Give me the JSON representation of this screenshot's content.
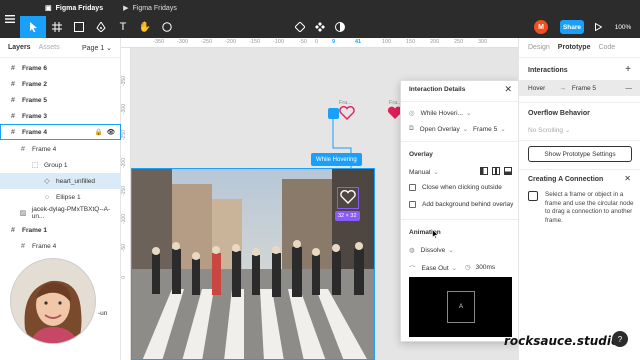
{
  "toolbar": {
    "tabs": [
      "Figma Fridays",
      "Figma Fridays"
    ],
    "avatar_letter": "M",
    "share_label": "Share",
    "zoom": "100%"
  },
  "left_panel": {
    "tab_layers": "Layers",
    "tab_assets": "Assets",
    "page": "Page 1",
    "layers": [
      {
        "label": "Frame 6"
      },
      {
        "label": "Frame 2"
      },
      {
        "label": "Frame 5"
      },
      {
        "label": "Frame 3"
      },
      {
        "label": "Frame 4"
      },
      {
        "label": "Frame 4"
      },
      {
        "label": "Group 1"
      },
      {
        "label": "heart_unfilled"
      },
      {
        "label": "Ellipse 1"
      },
      {
        "label": "jacek-dylag-PMxTBXtQ--A-un..."
      },
      {
        "label": "Frame 1"
      },
      {
        "label": "Frame 4"
      }
    ],
    "partial_text": "-un"
  },
  "ruler": {
    "top_labels": [
      "-350",
      "-300",
      "-250",
      "-200",
      "-150",
      "-100",
      "-50",
      "0",
      "9",
      "41",
      "100",
      "150",
      "200",
      "250",
      "300"
    ],
    "left_labels": [
      "-350",
      "-300",
      "-250",
      "-200",
      "-150",
      "-100",
      "-50",
      "0"
    ]
  },
  "canvas": {
    "frame_label_1": "Fra...",
    "frame_label_2": "Fra...",
    "hover_badge": "While Hovering",
    "size_badge": "32 × 32"
  },
  "popup": {
    "title": "Interaction Details",
    "trigger": "While Hoveri...",
    "action": "Open Overlay",
    "destination": "Frame 5",
    "overlay_title": "Overlay",
    "position": "Manual",
    "close_outside": "Close when clicking outside",
    "add_background": "Add background behind overlay",
    "animation_title": "Animation",
    "animation_type": "Dissolve",
    "easing": "Ease Out",
    "duration": "300ms",
    "preview_letter": "A"
  },
  "right_panel": {
    "tab_design": "Design",
    "tab_prototype": "Prototype",
    "tab_code": "Code",
    "interactions_title": "Interactions",
    "interaction_trigger": "Hover",
    "interaction_target": "Frame 5",
    "overflow_title": "Overflow Behavior",
    "overflow_value": "No Scrolling",
    "show_settings": "Show Prototype Settings",
    "connection_title": "Creating A Connection",
    "connection_desc": "Select a frame or object in a frame and use the circular node to drag a connection to another frame."
  },
  "watermark": "rocksauce.studio",
  "colors": {
    "accent": "#18a0fb",
    "toolbar": "#2c2c2c",
    "avatar": "#f24e1e",
    "heart": "#e01e5a"
  }
}
